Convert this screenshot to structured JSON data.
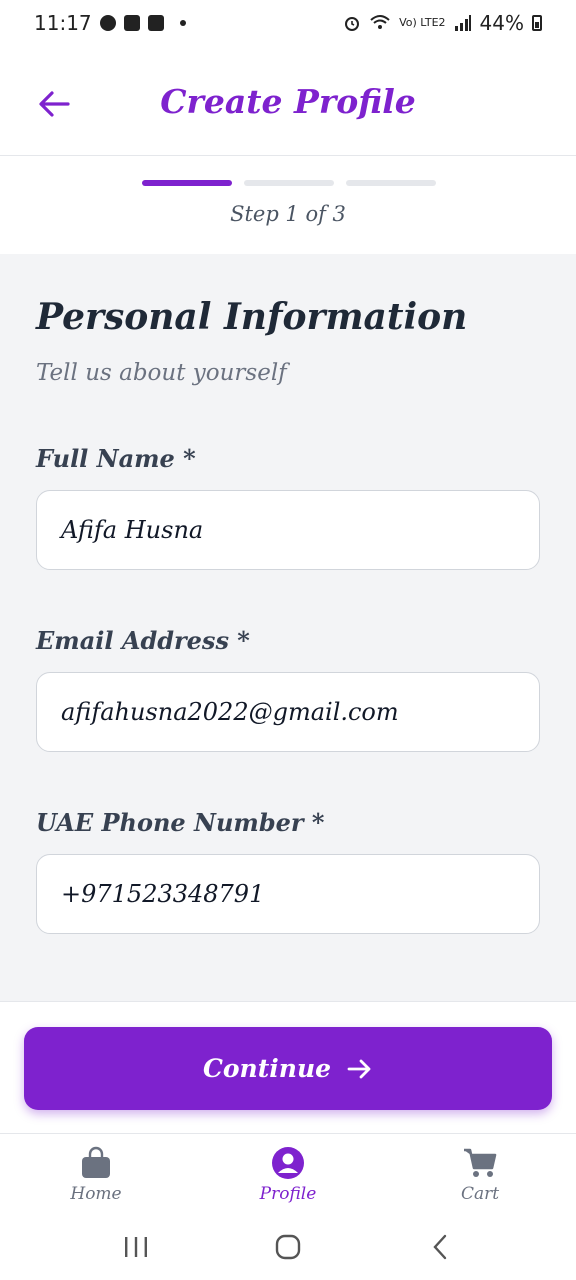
{
  "status_bar": {
    "time": "11:17",
    "battery_percent": "44%",
    "network_label": "Vo) LTE2"
  },
  "header": {
    "title": "Create Profile",
    "back_icon": "arrow-left-icon"
  },
  "progress": {
    "step_text": "Step 1 of 3",
    "current_step": 1,
    "total_steps": 3
  },
  "form": {
    "title": "Personal Information",
    "subtitle": "Tell us about yourself",
    "fields": [
      {
        "label": "Full Name *",
        "value": "Afifa Husna"
      },
      {
        "label": "Email Address *",
        "value": "afifahusna2022@gmail.com"
      },
      {
        "label": "UAE Phone Number *",
        "value": "+971523348791"
      }
    ]
  },
  "actions": {
    "continue_label": "Continue"
  },
  "bottom_nav": {
    "items": [
      {
        "label": "Home",
        "icon": "shopping-bag-icon",
        "active": false
      },
      {
        "label": "Profile",
        "icon": "user-circle-icon",
        "active": true
      },
      {
        "label": "Cart",
        "icon": "cart-icon",
        "active": false
      }
    ]
  },
  "colors": {
    "accent": "#7e22ce",
    "background": "#f3f4f6",
    "text": "#1f2937",
    "muted": "#6b7280"
  }
}
